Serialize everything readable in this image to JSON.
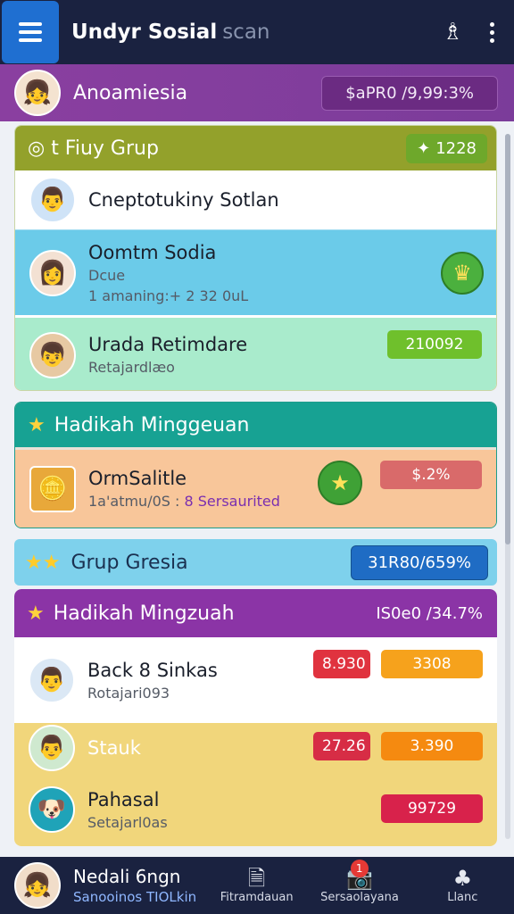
{
  "topbar": {
    "title": "Undyr Sosial",
    "title_dim": "scan",
    "icons": [
      "menu-icon",
      "pin-icon",
      "more-vertical-icon"
    ]
  },
  "profile": {
    "name": "Anoamiesia",
    "balance": "$aPR0 /9,99:3%"
  },
  "sections": {
    "group1": {
      "title": "◎ t Fiuy Grup",
      "pill": "1228",
      "row1_title": "Cneptotukiny Sotlan",
      "row2_title": "Oomtm Sodia",
      "row2_sub1": "Dcue",
      "row2_sub2": "1 amaning:+ 2 32 0uL",
      "row3_title": "Urada Retimdare",
      "row3_sub": "Retajardlæo",
      "row3_tag": "210092"
    },
    "group2": {
      "title": "Hadikah Minggeuan",
      "row_title": "OrmSalitle",
      "row_sub_a": "1a'atmu/0S :",
      "row_sub_b": "8 Sersaurited",
      "row_tag": "$.2%"
    },
    "group3": {
      "title": "Grup Gresia",
      "pill": "31R80/659%"
    },
    "group4": {
      "title": "Hadikah Mingzuah",
      "right": "IS0e0 /34.7%",
      "row1_title": "Back 8 Sinkas",
      "row1_sub": "Rotajari093",
      "row1_tag_red": "8.930",
      "row1_tag_orange": "3308",
      "row2_title": "Stauk",
      "row2_tag_red": "27.26",
      "row2_tag_orange": "3.390",
      "row3_title": "Pahasal",
      "row3_sub": "Setajarl0as",
      "row3_tag": "99729"
    }
  },
  "bottom_nav": {
    "user_name": "Nedali 6ngn",
    "user_sub": "Sanooinos TIOLkin",
    "items": [
      {
        "label": "Fitramdauan",
        "icon": "document-icon"
      },
      {
        "label": "Sersaolayana",
        "icon": "camera-icon",
        "badge": "1"
      },
      {
        "label": "Llanc",
        "icon": "club-icon"
      }
    ]
  },
  "colors": {
    "topbar": "#1a2240",
    "profile": "#8a3fa0",
    "group1_header": "#93a12b",
    "group2_header": "#17a293",
    "group4_header": "#8b34a6"
  }
}
